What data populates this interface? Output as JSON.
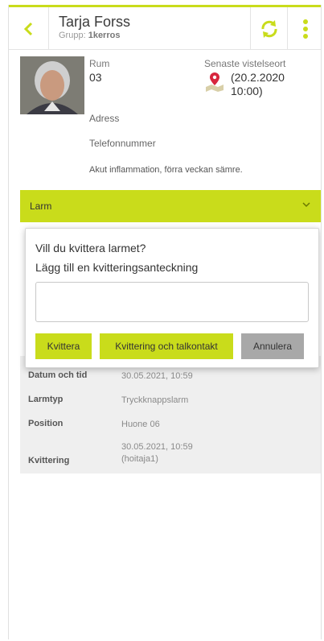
{
  "header": {
    "title": "Tarja Forss",
    "subtitle_prefix": "Grupp:",
    "subtitle_group": "1kerros"
  },
  "patient": {
    "room_label": "Rum",
    "room_value": "03",
    "last_seen_label": "Senaste vistelseort",
    "last_seen_value": "(20.2.2020 10:00)",
    "address_label": "Adress",
    "phone_label": "Telefonnummer",
    "note": "Akut inflammation, förra veckan sämre."
  },
  "alarm_section": {
    "label": "Larm"
  },
  "dialog": {
    "title": "Vill du kvittera larmet?",
    "subtitle": "Lägg till en kvitteringsanteckning",
    "input_value": "",
    "ack_button": "Kvittera",
    "ack_talk_button": "Kvittering och talkontakt",
    "cancel_button": "Annulera"
  },
  "details": [
    {
      "key": "Datum och tid",
      "value": "30.05.2021, 10:59"
    },
    {
      "key": "Larmtyp",
      "value": "Tryckknappslarm"
    },
    {
      "key": "Position",
      "value": "Huone 06"
    },
    {
      "key": "Kvittering",
      "value": "30.05.2021, 10:59 (hoitaja1)"
    }
  ],
  "colors": {
    "accent": "#c9dc1b",
    "cancel": "#a8a8a8",
    "pin": "#d7263d"
  }
}
